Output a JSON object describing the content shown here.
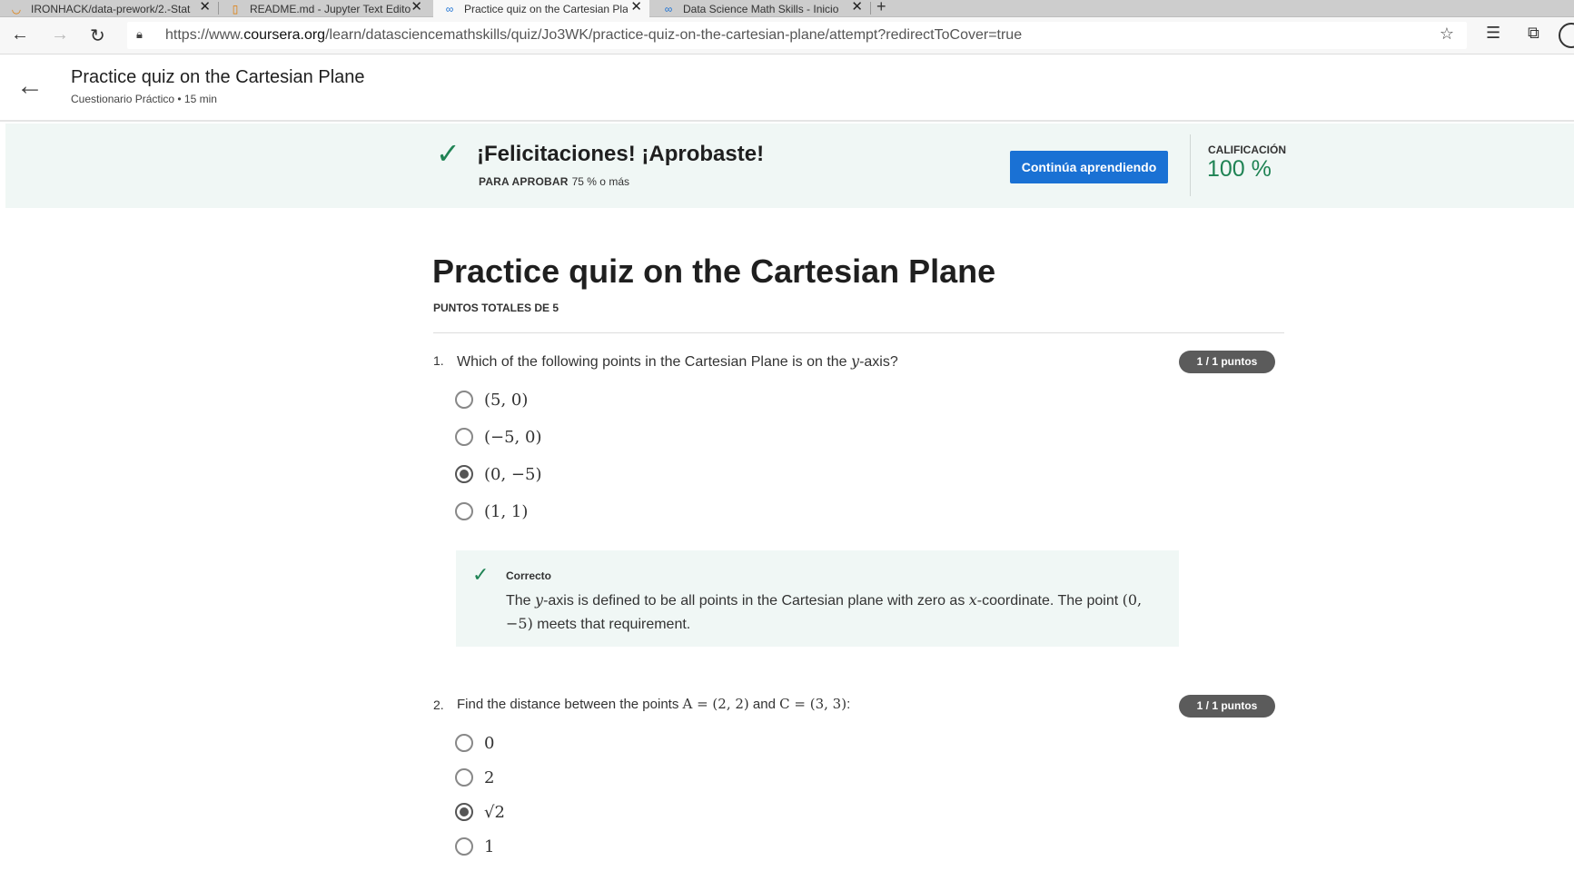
{
  "browser": {
    "tabs": [
      {
        "title": "IRONHACK/data-prework/2.-Stat",
        "favicon": "spinner-icon"
      },
      {
        "title": "README.md - Jupyter Text Edito",
        "favicon": "file-icon"
      },
      {
        "title": "Practice quiz on the Cartesian Pla",
        "favicon": "coursera-icon",
        "active": true
      },
      {
        "title": "Data Science Math Skills - Inicio",
        "favicon": "coursera-icon"
      }
    ],
    "close_glyph": "✕",
    "new_tab_glyph": "+",
    "url_prefix": "https://www.",
    "url_domain": "coursera.org",
    "url_path": "/learn/datasciencemathskills/quiz/Jo3WK/practice-quiz-on-the-cartesian-plane/attempt?redirectToCover=true"
  },
  "header": {
    "title": "Practice quiz on the Cartesian Plane",
    "subtitle": "Cuestionario Práctico • 15 min"
  },
  "banner": {
    "title": "¡Felicitaciones! ¡Aprobaste!",
    "pass_label": "PARA APROBAR",
    "pass_value": "75 % o más",
    "continue_button": "Continúa aprendiendo",
    "grade_label": "CALIFICACIÓN",
    "grade_value": "100 %",
    "accent_color": "#1f8354"
  },
  "quiz": {
    "title": "Practice quiz on the Cartesian Plane",
    "total_points": "PUNTOS TOTALES DE 5",
    "questions": [
      {
        "number": "1.",
        "text_before": "Which of the following points in the Cartesian Plane is on the ",
        "text_math": "y",
        "text_after": "-axis?",
        "points": "1 / 1 puntos",
        "options": [
          "(5, 0)",
          "(−5, 0)",
          "(0, −5)",
          "(1, 1)"
        ],
        "selected_index": 2,
        "feedback_label": "Correcto",
        "feedback_p1": "The ",
        "feedback_m1": "y",
        "feedback_p2": "-axis is defined to be all points in the Cartesian plane with zero as ",
        "feedback_m2": "x",
        "feedback_p3": "-coordinate. The point ",
        "feedback_m3": "(0, −5)",
        "feedback_p4": " meets that requirement."
      },
      {
        "number": "2.",
        "text_before": "Find the distance between the points ",
        "text_m1": "A = (2, 2)",
        "text_mid": " and ",
        "text_m2": "C = (3, 3)",
        "text_after": ":",
        "points": "1 / 1 puntos",
        "options": [
          "0",
          "2",
          "√2",
          "1"
        ],
        "selected_index": 2
      }
    ]
  }
}
